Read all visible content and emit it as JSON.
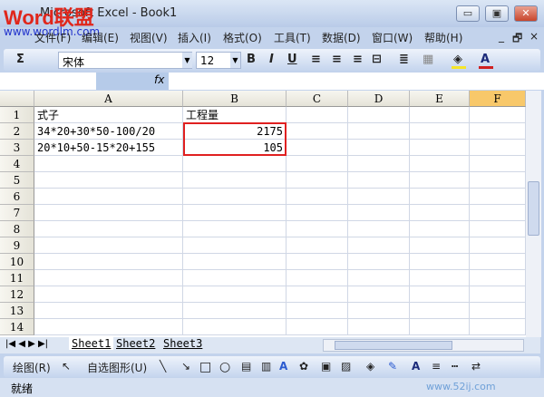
{
  "window": {
    "title": "Microsoft Excel - Book1",
    "logo_text": "Word联盟",
    "logo_url": "www.wordlm.com",
    "minimize": "▭",
    "restore": "▣",
    "close": "✕"
  },
  "menu": [
    "文件(F)",
    "编辑(E)",
    "视图(V)",
    "插入(I)",
    "格式(O)",
    "工具(T)",
    "数据(D)",
    "窗口(W)",
    "帮助(H)"
  ],
  "doc_controls": {
    "minimize": "_",
    "restore": "🗗",
    "close": "×"
  },
  "toolbar": {
    "autosum": "Σ",
    "font": "宋体",
    "size": "12",
    "bold": "B",
    "italic": "I",
    "underline": "U",
    "fill_color": "#f5e52a",
    "font_color": "#d02020"
  },
  "formula_bar": {
    "fx": "fx",
    "name_box": "",
    "value": ""
  },
  "columns": [
    "A",
    "B",
    "C",
    "D",
    "E",
    "F"
  ],
  "rows": [
    {
      "n": "1",
      "A": "式子",
      "B": ""
    },
    {
      "n": "2",
      "A": "34*20+30*50-100/20",
      "B": "2175"
    },
    {
      "n": "3",
      "A": "20*10+50-15*20+155",
      "B": "105"
    },
    {
      "n": "4"
    },
    {
      "n": "5"
    },
    {
      "n": "6"
    },
    {
      "n": "7"
    },
    {
      "n": "8"
    },
    {
      "n": "9"
    },
    {
      "n": "10"
    },
    {
      "n": "11"
    },
    {
      "n": "12"
    },
    {
      "n": "13"
    },
    {
      "n": "14"
    }
  ],
  "b1": "工程量",
  "sheets": [
    "Sheet1",
    "Sheet2",
    "Sheet3"
  ],
  "drawing": {
    "draw": "绘图(R)",
    "autoshapes": "自选图形(U)"
  },
  "status": "就绪",
  "watermark": "www.52ij.com"
}
